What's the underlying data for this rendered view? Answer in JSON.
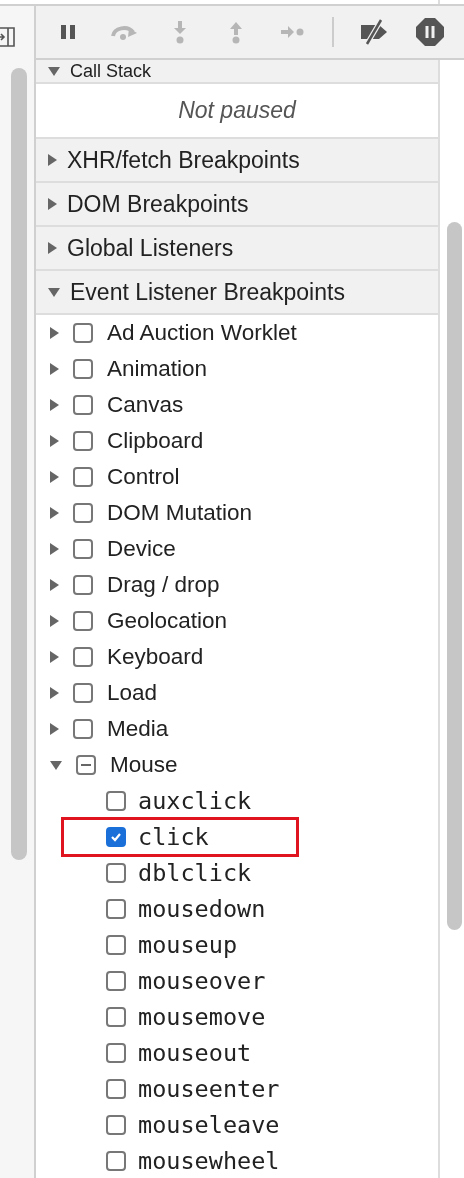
{
  "toolbar": [
    {
      "kind": "pause",
      "disabled": false
    },
    {
      "kind": "step-over",
      "disabled": true
    },
    {
      "kind": "step-into",
      "disabled": true
    },
    {
      "kind": "step-out",
      "disabled": true
    },
    {
      "kind": "step",
      "disabled": true
    },
    {
      "kind": "separator"
    },
    {
      "kind": "deactivate",
      "disabled": false
    },
    {
      "kind": "pause-exceptions",
      "disabled": false
    }
  ],
  "call_stack": {
    "title": "Call Stack",
    "expanded": true,
    "message": "Not paused"
  },
  "sections": [
    {
      "title": "XHR/fetch Breakpoints",
      "expanded": false
    },
    {
      "title": "DOM Breakpoints",
      "expanded": false
    },
    {
      "title": "Global Listeners",
      "expanded": false
    },
    {
      "title": "Event Listener Breakpoints",
      "expanded": true
    }
  ],
  "categories": [
    {
      "label": "Ad Auction Worklet",
      "expanded": false,
      "checked": false,
      "indeterminate": false
    },
    {
      "label": "Animation",
      "expanded": false,
      "checked": false,
      "indeterminate": false
    },
    {
      "label": "Canvas",
      "expanded": false,
      "checked": false,
      "indeterminate": false
    },
    {
      "label": "Clipboard",
      "expanded": false,
      "checked": false,
      "indeterminate": false
    },
    {
      "label": "Control",
      "expanded": false,
      "checked": false,
      "indeterminate": false
    },
    {
      "label": "DOM Mutation",
      "expanded": false,
      "checked": false,
      "indeterminate": false
    },
    {
      "label": "Device",
      "expanded": false,
      "checked": false,
      "indeterminate": false
    },
    {
      "label": "Drag / drop",
      "expanded": false,
      "checked": false,
      "indeterminate": false
    },
    {
      "label": "Geolocation",
      "expanded": false,
      "checked": false,
      "indeterminate": false
    },
    {
      "label": "Keyboard",
      "expanded": false,
      "checked": false,
      "indeterminate": false
    },
    {
      "label": "Load",
      "expanded": false,
      "checked": false,
      "indeterminate": false
    },
    {
      "label": "Media",
      "expanded": false,
      "checked": false,
      "indeterminate": false
    },
    {
      "label": "Mouse",
      "expanded": true,
      "indeterminate": true,
      "children": [
        {
          "label": "auxclick",
          "checked": false,
          "highlighted": false
        },
        {
          "label": "click",
          "checked": true,
          "highlighted": true
        },
        {
          "label": "dblclick",
          "checked": false,
          "highlighted": false
        },
        {
          "label": "mousedown",
          "checked": false,
          "highlighted": false
        },
        {
          "label": "mouseup",
          "checked": false,
          "highlighted": false
        },
        {
          "label": "mouseover",
          "checked": false,
          "highlighted": false
        },
        {
          "label": "mousemove",
          "checked": false,
          "highlighted": false
        },
        {
          "label": "mouseout",
          "checked": false,
          "highlighted": false
        },
        {
          "label": "mouseenter",
          "checked": false,
          "highlighted": false
        },
        {
          "label": "mouseleave",
          "checked": false,
          "highlighted": false
        },
        {
          "label": "mousewheel",
          "checked": false,
          "highlighted": false
        }
      ]
    }
  ]
}
